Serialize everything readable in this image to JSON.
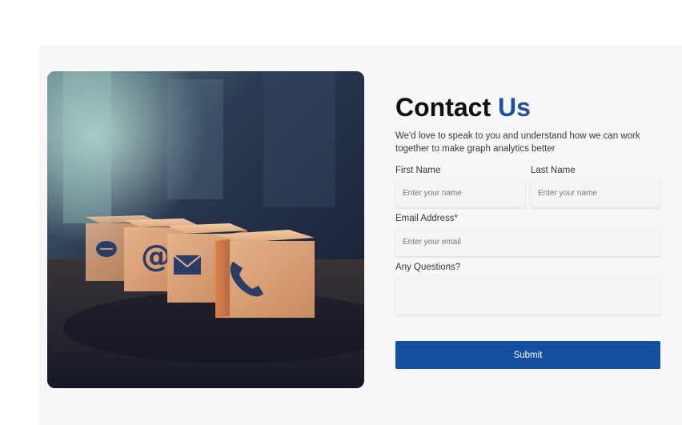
{
  "contact": {
    "title_main": "Contact ",
    "title_accent": "Us",
    "subtitle": "We'd love to speak to you and understand how we can work together to make graph analytics better",
    "first_name": {
      "label": "First Name",
      "placeholder": "Enter your name"
    },
    "last_name": {
      "label": "Last Name",
      "placeholder": "Enter your name"
    },
    "email": {
      "label": "Email Address*",
      "placeholder": "Enter your email"
    },
    "questions": {
      "label": "Any Questions?",
      "placeholder": ""
    },
    "submit_label": "Submit"
  },
  "image": {
    "icons": [
      "chat-bubble-icon",
      "at-sign-icon",
      "envelope-icon",
      "phone-icon"
    ],
    "at_glyph": "@"
  },
  "colors": {
    "accent": "#1c4f9c",
    "button": "#134f9e",
    "section_bg": "#f7f7f7"
  }
}
